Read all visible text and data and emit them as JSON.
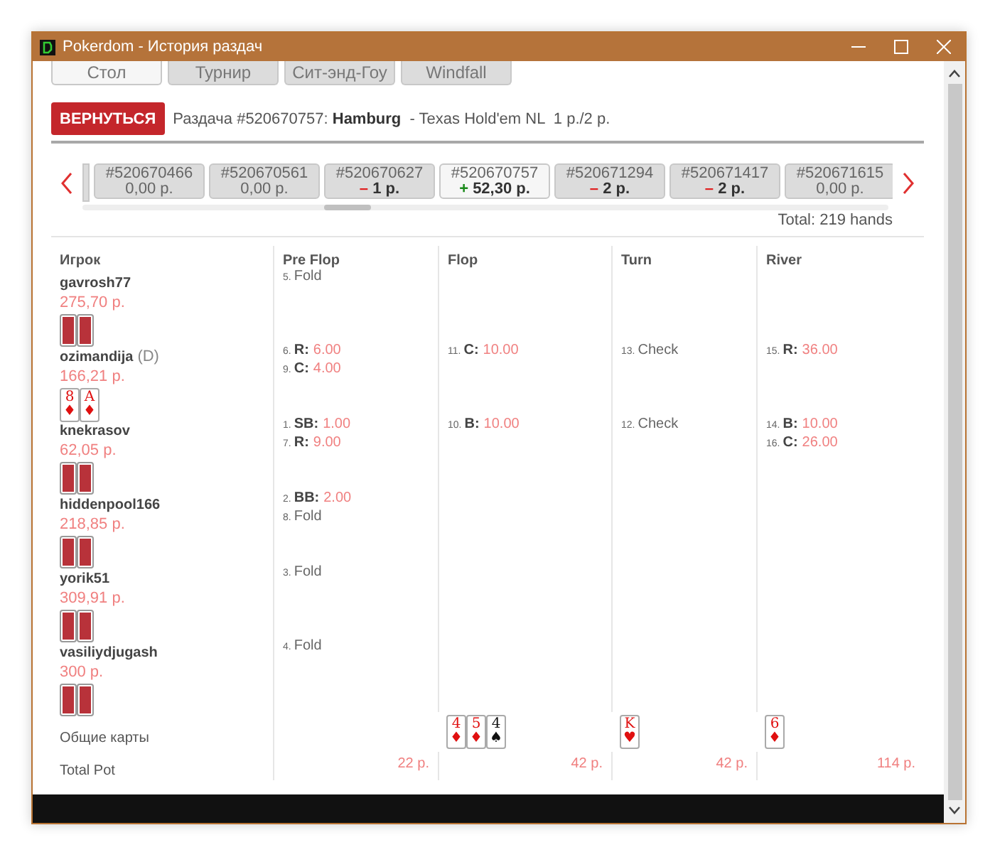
{
  "window": {
    "title": "Pokerdom - История раздач"
  },
  "tabs": [
    {
      "label": "Стол",
      "selected": true
    },
    {
      "label": "Турнир",
      "selected": false
    },
    {
      "label": "Сит-энд-Гоу",
      "selected": false
    },
    {
      "label": "Windfall",
      "selected": false
    }
  ],
  "back_button": "ВЕРНУТЬСЯ",
  "hand_info": "Раздача #520670757: **Hamburg**  - Texas Hold'em NL  1 р./2 р.",
  "hands": [
    {
      "id": "#520670466",
      "amount": "0,00 р.",
      "kind": "even",
      "selected": false
    },
    {
      "id": "#520670561",
      "amount": "0,00 р.",
      "kind": "even",
      "selected": false
    },
    {
      "id": "#520670627",
      "sign": "–",
      "amount": "1 р.",
      "kind": "loss",
      "selected": false
    },
    {
      "id": "#520670757",
      "sign": "+",
      "amount": "52,30 р.",
      "kind": "win",
      "selected": true
    },
    {
      "id": "#520671294",
      "sign": "–",
      "amount": "2 р.",
      "kind": "loss",
      "selected": false
    },
    {
      "id": "#520671417",
      "sign": "–",
      "amount": "2 р.",
      "kind": "loss",
      "selected": false
    },
    {
      "id": "#520671615",
      "amount": "0,00 р.",
      "kind": "even",
      "selected": false
    }
  ],
  "total": "Total: 219 hands",
  "columns": [
    "Игрок",
    "Pre Flop",
    "Flop",
    "Turn",
    "River"
  ],
  "players": [
    {
      "name": "gavrosh77",
      "stack": "275,70 р.",
      "cards": [
        {
          "face_up": false
        },
        {
          "face_up": false
        }
      ],
      "preflop": [
        {
          "num": "5.",
          "kind": "fold",
          "label": "Fold"
        }
      ]
    },
    {
      "name": "ozimandija",
      "dealer": "(D)",
      "stack": "166,21 р.",
      "cards": [
        {
          "face_up": true,
          "rank": "8",
          "suit": "♦",
          "color": "#e01010"
        },
        {
          "face_up": true,
          "rank": "A",
          "suit": "♦",
          "color": "#e01010"
        }
      ],
      "preflop": [
        {
          "num": "6.",
          "kind": "bet",
          "label": "R:",
          "amount": "6.00"
        },
        {
          "num": "9.",
          "kind": "bet",
          "label": "C:",
          "amount": "4.00"
        }
      ],
      "flop": [
        {
          "num": "11.",
          "kind": "bet",
          "label": "C:",
          "amount": "10.00"
        }
      ],
      "turn": [
        {
          "num": "13.",
          "kind": "fold",
          "label": "Check"
        }
      ],
      "river": [
        {
          "num": "15.",
          "kind": "bet",
          "label": "R:",
          "amount": "36.00"
        }
      ]
    },
    {
      "name": "knekrasov",
      "stack": "62,05 р.",
      "cards": [
        {
          "face_up": false
        },
        {
          "face_up": false
        }
      ],
      "preflop": [
        {
          "num": "1.",
          "kind": "bet",
          "label": "SB:",
          "amount": "1.00"
        },
        {
          "num": "7.",
          "kind": "bet",
          "label": "R:",
          "amount": "9.00"
        }
      ],
      "flop": [
        {
          "num": "10.",
          "kind": "bet",
          "label": "B:",
          "amount": "10.00"
        }
      ],
      "turn": [
        {
          "num": "12.",
          "kind": "fold",
          "label": "Check"
        }
      ],
      "river": [
        {
          "num": "14.",
          "kind": "bet",
          "label": "B:",
          "amount": "10.00"
        },
        {
          "num": "16.",
          "kind": "bet",
          "label": "C:",
          "amount": "26.00"
        }
      ]
    },
    {
      "name": "hiddenpool166",
      "stack": "218,85 р.",
      "cards": [
        {
          "face_up": false
        },
        {
          "face_up": false
        }
      ],
      "preflop": [
        {
          "num": "2.",
          "kind": "bet",
          "label": "BB:",
          "amount": "2.00"
        },
        {
          "num": "8.",
          "kind": "fold",
          "label": "Fold"
        }
      ]
    },
    {
      "name": "yorik51",
      "stack": "309,91 р.",
      "cards": [
        {
          "face_up": false
        },
        {
          "face_up": false
        }
      ],
      "preflop": [
        {
          "num": "3.",
          "kind": "fold",
          "label": "Fold"
        }
      ]
    },
    {
      "name": "vasiliydjugash",
      "stack": "300 р.",
      "cards": [
        {
          "face_up": false
        },
        {
          "face_up": false
        }
      ],
      "preflop": [
        {
          "num": "4.",
          "kind": "fold",
          "label": "Fold"
        }
      ]
    }
  ],
  "community": {
    "label": "Общие карты",
    "flop": [
      {
        "rank": "4",
        "suit": "♦",
        "color": "#e01010"
      },
      {
        "rank": "5",
        "suit": "♦",
        "color": "#e01010"
      },
      {
        "rank": "4",
        "suit": "♠",
        "color": "#111111"
      }
    ],
    "turn": [
      {
        "rank": "K",
        "suit": "♥",
        "color": "#e01010"
      }
    ],
    "river": [
      {
        "rank": "6",
        "suit": "♦",
        "color": "#e01010"
      }
    ]
  },
  "total_pot": {
    "label": "Total Pot",
    "values": [
      "22 р.",
      "42 р.",
      "42 р.",
      "114 р."
    ]
  }
}
